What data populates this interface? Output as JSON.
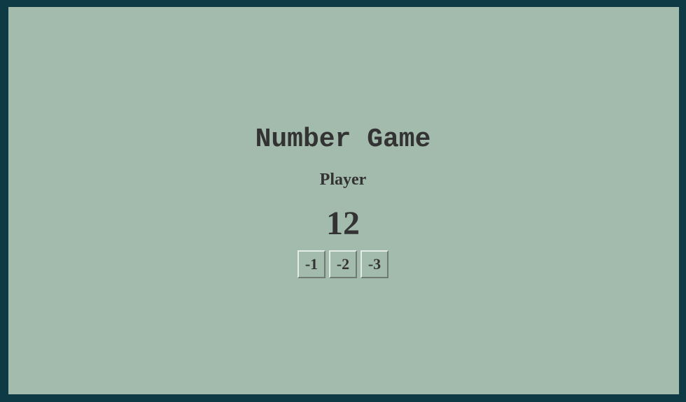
{
  "game": {
    "title": "Number Game",
    "player_label": "Player",
    "current_number": "12",
    "buttons": [
      {
        "label": "-1"
      },
      {
        "label": "-2"
      },
      {
        "label": "-3"
      }
    ]
  },
  "colors": {
    "frame_border": "#0e3a45",
    "background": "#a3bbad",
    "text": "#333333"
  }
}
